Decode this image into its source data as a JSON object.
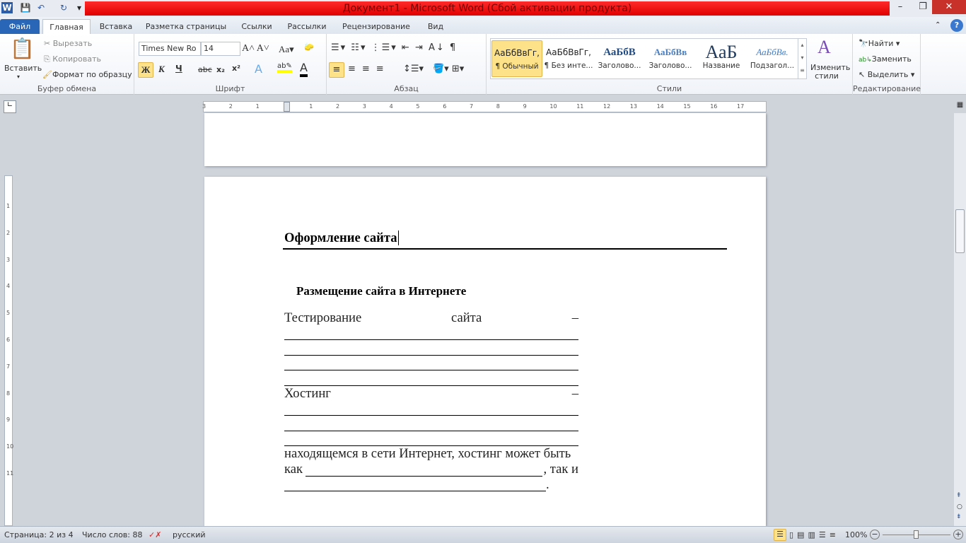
{
  "window": {
    "title": "Документ1 - Microsoft Word (Сбой активации продукта)"
  },
  "tabs": [
    "Файл",
    "Главная",
    "Вставка",
    "Разметка страницы",
    "Ссылки",
    "Рассылки",
    "Рецензирование",
    "Вид"
  ],
  "clipboard": {
    "paste": "Вставить",
    "cut": "Вырезать",
    "copy": "Копировать",
    "format_painter": "Формат по образцу",
    "label": "Буфер обмена"
  },
  "font": {
    "name": "Times New Ro",
    "size": "14",
    "label": "Шрифт",
    "bold": "Ж",
    "italic": "К",
    "underline": "Ч"
  },
  "paragraph": {
    "label": "Абзац"
  },
  "styles": {
    "label": "Стили",
    "items": [
      {
        "sample": "АаБбВвГг,",
        "name": "¶ Обычный"
      },
      {
        "sample": "АаБбВвГг,",
        "name": "¶ Без инте..."
      },
      {
        "sample": "АаБбВ",
        "name": "Заголово..."
      },
      {
        "sample": "АаБбВв",
        "name": "Заголово..."
      },
      {
        "sample": "АаБ",
        "name": "Название"
      },
      {
        "sample": "АаБбВв.",
        "name": "Подзагол..."
      }
    ],
    "change": "Изменить стили"
  },
  "editing": {
    "find": "Найти",
    "replace": "Заменить",
    "select": "Выделить",
    "label": "Редактирование"
  },
  "ruler": {
    "h": [
      "3",
      "2",
      "1",
      "",
      "1",
      "2",
      "3",
      "4",
      "5",
      "6",
      "7",
      "8",
      "9",
      "10",
      "11",
      "12",
      "13",
      "14",
      "15",
      "16",
      "17"
    ],
    "v": [
      "1",
      "2",
      "3",
      "4",
      "5",
      "6",
      "7",
      "8",
      "9",
      "10",
      "11"
    ]
  },
  "document": {
    "header": "Оформление сайта",
    "heading": "Размещение сайта в Интернете",
    "line1a": "Тестирование",
    "line1b": "сайта",
    "dash": "–",
    "line5": "Хостинг",
    "line9": "находящемся в сети Интернет, хостинг может быть",
    "line10a": "как",
    "line10b": ", так и",
    "line11": "."
  },
  "status": {
    "page": "Страница: 2 из 4",
    "words": "Число слов: 88",
    "lang": "русский",
    "zoom": "100%"
  }
}
